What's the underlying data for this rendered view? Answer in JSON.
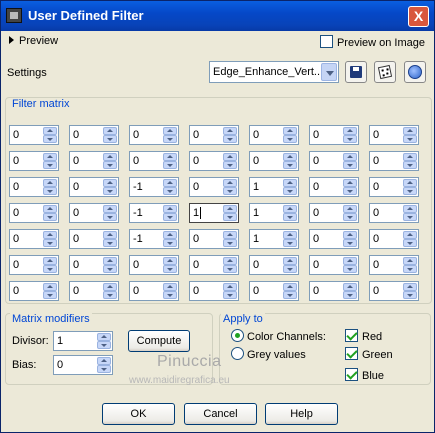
{
  "window": {
    "title": "User Defined Filter",
    "close_label": "X"
  },
  "preview": {
    "label": "Preview",
    "on_image_label": "Preview on Image",
    "on_image_checked": false
  },
  "settings": {
    "label": "Settings",
    "preset": "Edge_Enhance_Vert..."
  },
  "icons": {
    "save": "save-disk-icon",
    "random": "dice-icon",
    "reset": "reset-icon"
  },
  "filter_matrix": {
    "title": "Filter matrix",
    "rows": [
      [
        "0",
        "0",
        "0",
        "0",
        "0",
        "0",
        "0"
      ],
      [
        "0",
        "0",
        "0",
        "0",
        "0",
        "0",
        "0"
      ],
      [
        "0",
        "0",
        "-1",
        "0",
        "1",
        "0",
        "0"
      ],
      [
        "0",
        "0",
        "-1",
        "1",
        "1",
        "0",
        "0"
      ],
      [
        "0",
        "0",
        "-1",
        "0",
        "1",
        "0",
        "0"
      ],
      [
        "0",
        "0",
        "0",
        "0",
        "0",
        "0",
        "0"
      ],
      [
        "0",
        "0",
        "0",
        "0",
        "0",
        "0",
        "0"
      ]
    ]
  },
  "matrix_modifiers": {
    "title": "Matrix modifiers",
    "divisor_label": "Divisor:",
    "divisor": "1",
    "bias_label": "Bias:",
    "bias": "0",
    "compute_label": "Compute"
  },
  "apply_to": {
    "title": "Apply to",
    "color_channels_label": "Color Channels:",
    "grey_values_label": "Grey values",
    "selected": "color",
    "red_label": "Red",
    "green_label": "Green",
    "blue_label": "Blue"
  },
  "watermark": {
    "name": "Pinuccia",
    "url": "www.maidiregrafica.eu"
  },
  "buttons": {
    "ok": "OK",
    "cancel": "Cancel",
    "help": "Help"
  },
  "colors": {
    "titlebar": "#0548c8",
    "dialog_bg": "#ece9d8",
    "group_title": "#0046d5"
  }
}
